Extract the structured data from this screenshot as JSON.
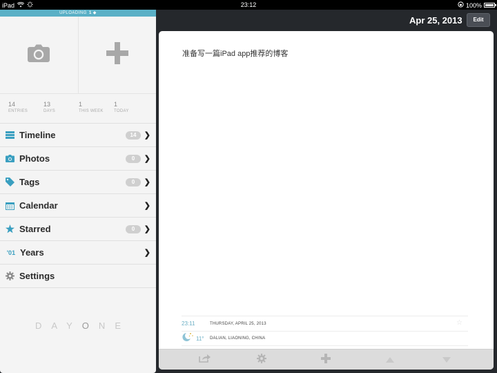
{
  "status_bar": {
    "device": "iPad",
    "time": "23:12",
    "battery": "100%",
    "battery_level": 1.0
  },
  "sidebar": {
    "upload": {
      "label": "UPLOADING",
      "count": "1"
    },
    "quick_actions": [
      {
        "name": "camera-icon"
      },
      {
        "name": "plus-icon"
      }
    ],
    "stats": [
      {
        "value": "14",
        "label": "ENTRIES"
      },
      {
        "value": "13",
        "label": "DAYS"
      },
      {
        "value": "1",
        "label": "THIS WEEK"
      },
      {
        "value": "1",
        "label": "TODAY"
      }
    ],
    "items": [
      {
        "label": "Timeline",
        "badge": "14",
        "icon": "list-icon"
      },
      {
        "label": "Photos",
        "badge": "0",
        "icon": "camera-icon"
      },
      {
        "label": "Tags",
        "badge": "0",
        "icon": "tag-icon"
      },
      {
        "label": "Calendar",
        "badge": "",
        "icon": "calendar-icon"
      },
      {
        "label": "Starred",
        "badge": "0",
        "icon": "star-icon"
      },
      {
        "label": "Years",
        "badge": "",
        "icon": "years-icon",
        "icon_text": "'01"
      },
      {
        "label": "Settings",
        "badge": "",
        "icon": "gear-icon"
      }
    ],
    "logo": "DAYONE"
  },
  "header": {
    "date": "Apr 25, 2013",
    "edit_label": "Edit"
  },
  "entry": {
    "text": "准备写一篇iPad app推荐的博客",
    "time": "23:11",
    "date_line": "THURSDAY, APRIL 25, 2013",
    "temperature": "11°",
    "location": "DALIAN, LIAONING, CHINA"
  },
  "toolbar": [
    "share-icon",
    "gear-icon",
    "plus-icon",
    "up-arrow-icon",
    "down-arrow-icon"
  ],
  "colors": {
    "accent": "#5ab0c6",
    "background": "#25282c",
    "badge": "#cfcfcf"
  }
}
